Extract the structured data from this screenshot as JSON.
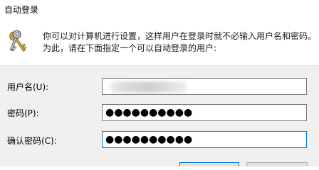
{
  "window": {
    "title": "自动登录"
  },
  "info": {
    "icon": "key-icon",
    "description": "你可以对计算机进行设置，这样用户在登录时就不必输入用户名和密码。为此，请在下面指定一个可以自动登录的用户:"
  },
  "form": {
    "username_label": "用户名(U):",
    "username_value": "",
    "password_label": "密码(P):",
    "password_value": "●●●●●●●●●●",
    "confirm_label": "确认密码(C):",
    "confirm_value": "●●●●●●●●●●"
  },
  "colors": {
    "focus_border": "#0078d7",
    "panel_background": "#f0f0f0"
  }
}
